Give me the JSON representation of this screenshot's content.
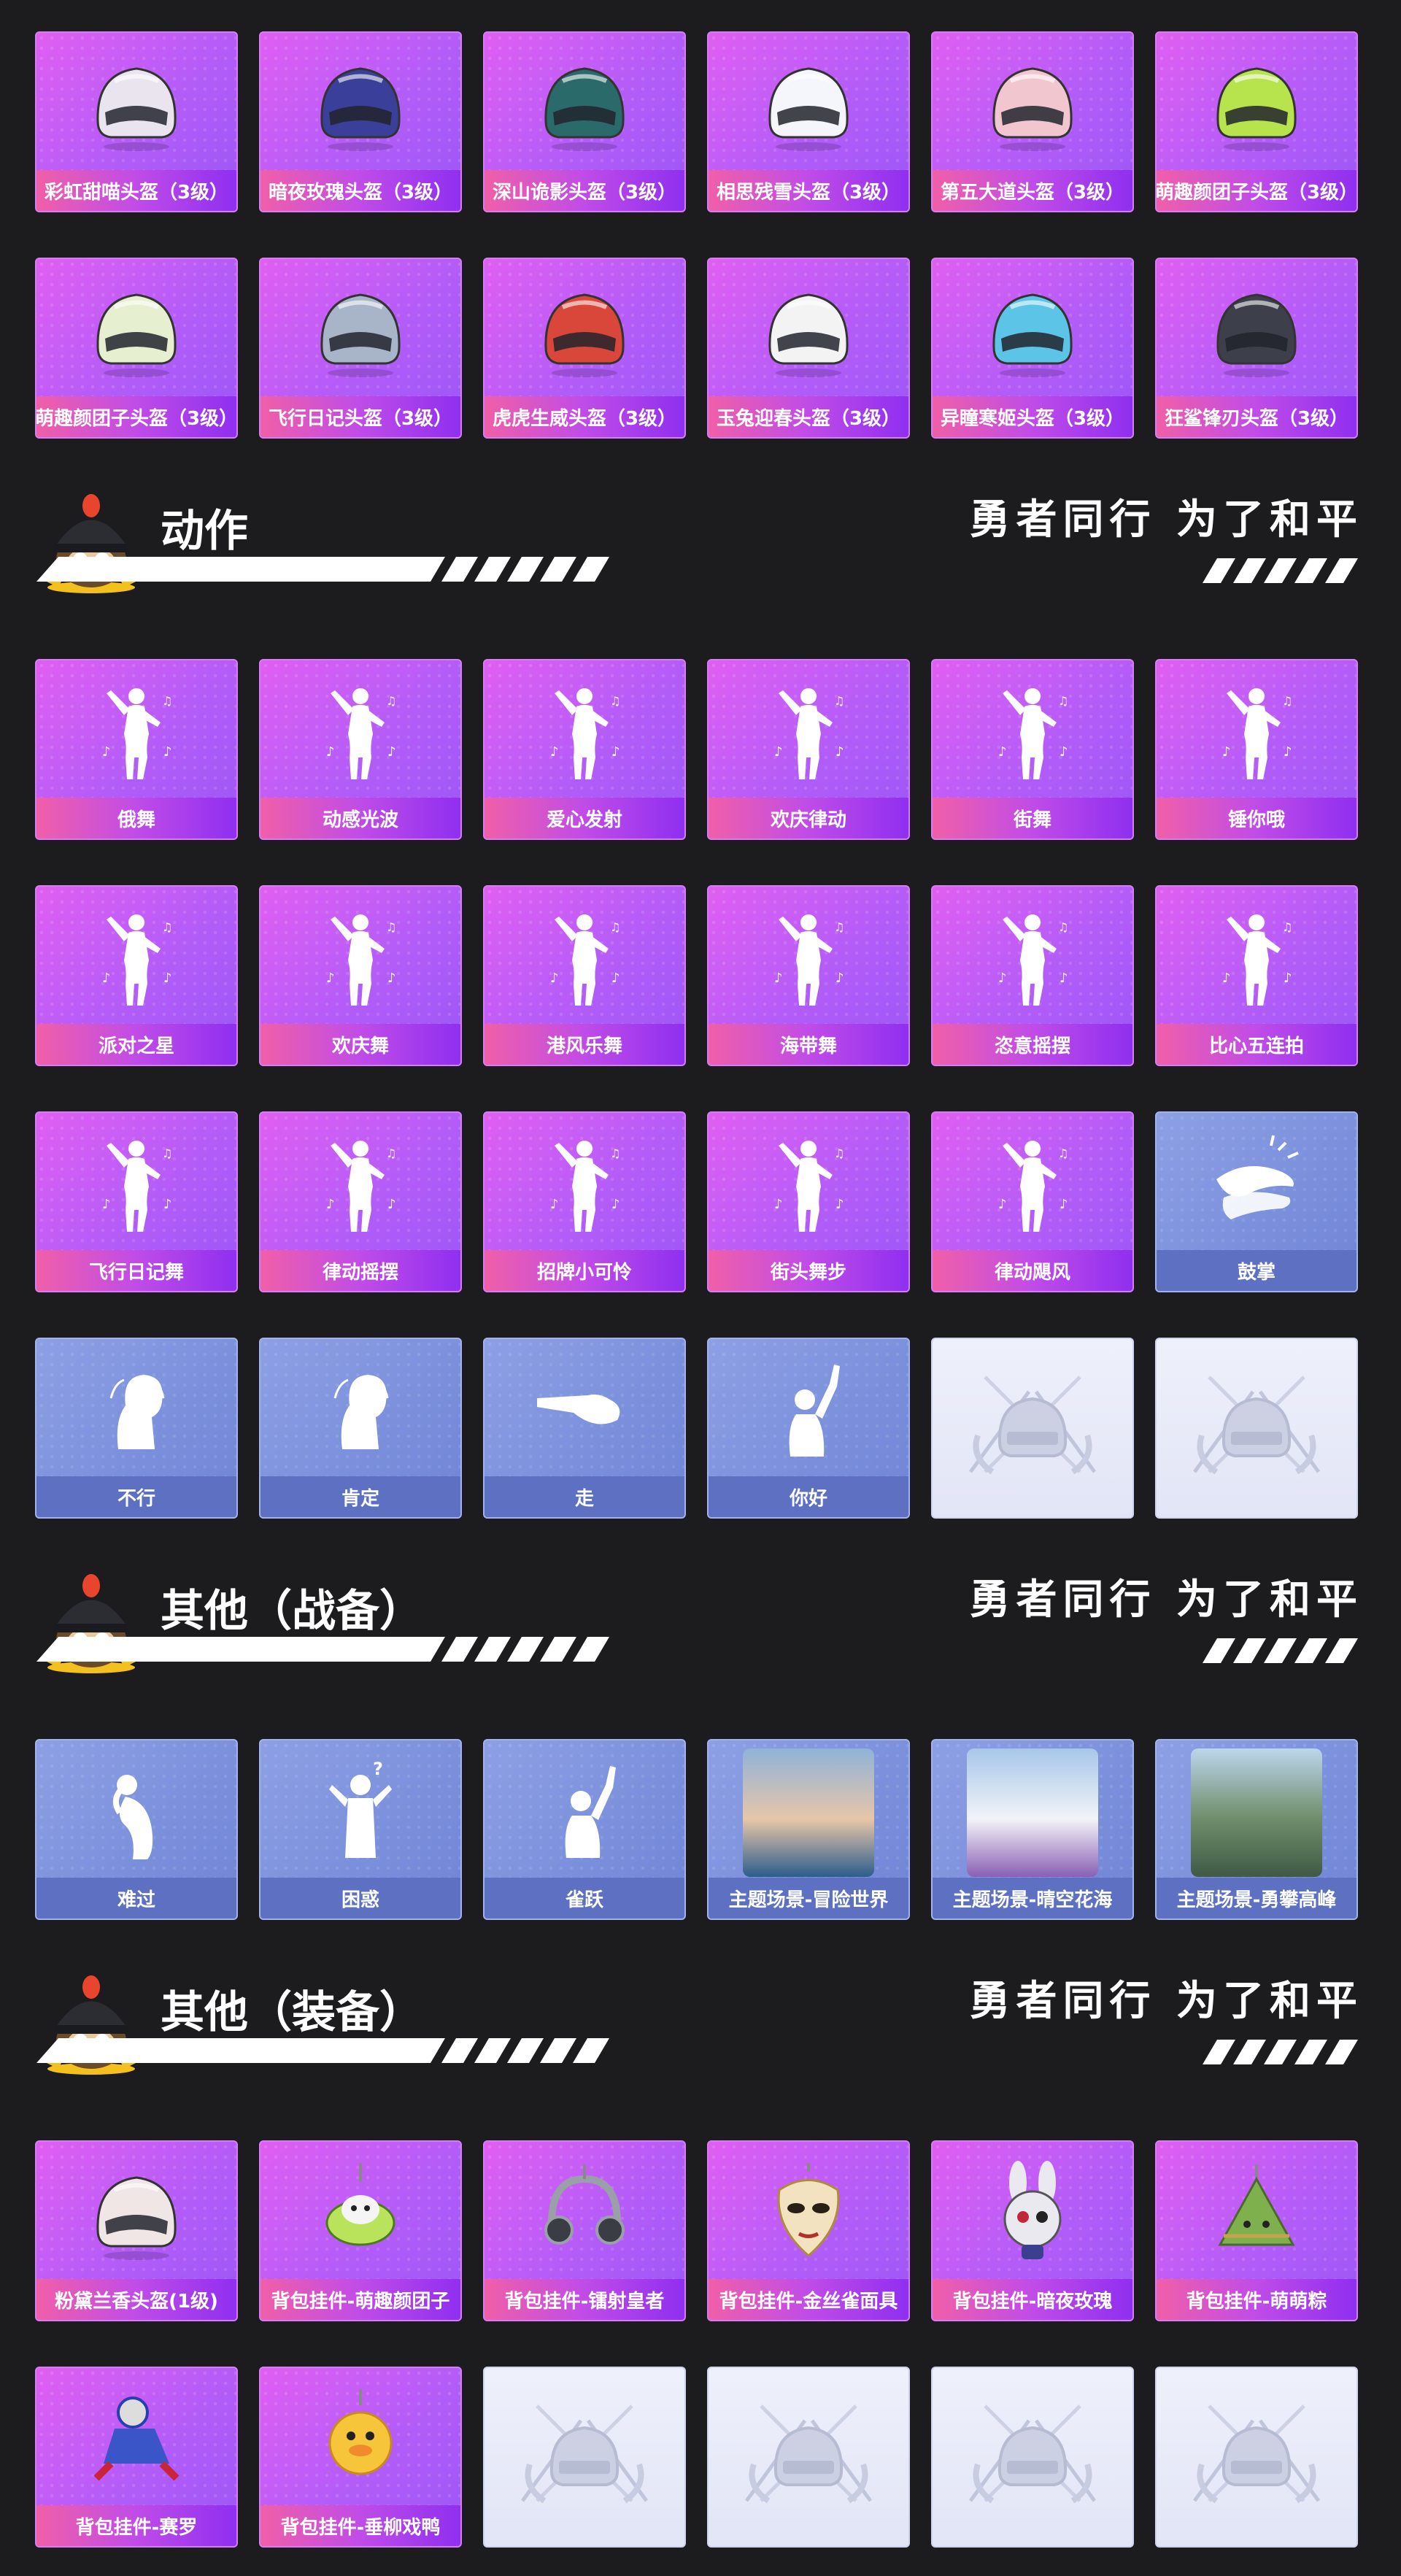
{
  "sections": {
    "helmets": {
      "rows": [
        [
          {
            "label": "彩虹甜喵头盔（3级）",
            "style": "purple",
            "icon": "helmet-icon",
            "color": "#e9e4ee"
          },
          {
            "label": "暗夜玫瑰头盔（3级）",
            "style": "purple",
            "icon": "helmet-icon",
            "color": "#3a3f9a"
          },
          {
            "label": "深山诡影头盔（3级）",
            "style": "purple",
            "icon": "helmet-icon",
            "color": "#2b6a6a"
          },
          {
            "label": "相思残雪头盔（3级）",
            "style": "purple",
            "icon": "helmet-icon",
            "color": "#f4f6fb"
          },
          {
            "label": "第五大道头盔（3级）",
            "style": "purple",
            "icon": "helmet-icon",
            "color": "#f2c6cf"
          },
          {
            "label": "萌趣颜团子头盔（3级）",
            "style": "purple",
            "icon": "helmet-icon",
            "color": "#b7e34d"
          }
        ],
        [
          {
            "label": "萌趣颜团子头盔（3级）",
            "style": "purple",
            "icon": "helmet-icon",
            "color": "#e6f0d0"
          },
          {
            "label": "飞行日记头盔（3级）",
            "style": "purple",
            "icon": "helmet-icon",
            "color": "#a8b4c8"
          },
          {
            "label": "虎虎生威头盔（3级）",
            "style": "purple",
            "icon": "helmet-icon",
            "color": "#d8473a"
          },
          {
            "label": "玉兔迎春头盔（3级）",
            "style": "purple",
            "icon": "helmet-icon",
            "color": "#f3f3f3"
          },
          {
            "label": "异瞳寒姬头盔（3级）",
            "style": "purple",
            "icon": "helmet-icon",
            "color": "#5cc4e6"
          },
          {
            "label": "狂鲨锋刃头盔（3级）",
            "style": "purple",
            "icon": "helmet-icon",
            "color": "#3d3f4a"
          }
        ]
      ]
    },
    "actions": {
      "title": "动作",
      "slogan": "勇者同行 为了和平",
      "rows": [
        [
          {
            "label": "俄舞",
            "style": "purple",
            "icon": "dancer-icon"
          },
          {
            "label": "动感光波",
            "style": "purple",
            "icon": "dancer-icon"
          },
          {
            "label": "爱心发射",
            "style": "purple",
            "icon": "dancer-icon"
          },
          {
            "label": "欢庆律动",
            "style": "purple",
            "icon": "dancer-icon"
          },
          {
            "label": "街舞",
            "style": "purple",
            "icon": "dancer-icon"
          },
          {
            "label": "锤你哦",
            "style": "purple",
            "icon": "dancer-icon"
          }
        ],
        [
          {
            "label": "派对之星",
            "style": "purple",
            "icon": "dancer-icon"
          },
          {
            "label": "欢庆舞",
            "style": "purple",
            "icon": "dancer-icon"
          },
          {
            "label": "港风乐舞",
            "style": "purple",
            "icon": "dancer-icon"
          },
          {
            "label": "海带舞",
            "style": "purple",
            "icon": "dancer-icon"
          },
          {
            "label": "恣意摇摆",
            "style": "purple",
            "icon": "dancer-icon"
          },
          {
            "label": "比心五连拍",
            "style": "purple",
            "icon": "dancer-icon"
          }
        ],
        [
          {
            "label": "飞行日记舞",
            "style": "purple",
            "icon": "dancer-icon"
          },
          {
            "label": "律动摇摆",
            "style": "purple",
            "icon": "dancer-icon"
          },
          {
            "label": "招牌小可怜",
            "style": "purple",
            "icon": "dancer-icon"
          },
          {
            "label": "街头舞步",
            "style": "purple",
            "icon": "dancer-icon"
          },
          {
            "label": "律动飓风",
            "style": "purple",
            "icon": "dancer-icon"
          },
          {
            "label": "鼓掌",
            "style": "blue",
            "icon": "clap-icon"
          }
        ],
        [
          {
            "label": "不行",
            "style": "blue",
            "icon": "head-shake-icon"
          },
          {
            "label": "肯定",
            "style": "blue",
            "icon": "head-nod-icon"
          },
          {
            "label": "走",
            "style": "blue",
            "icon": "pointing-hand-icon"
          },
          {
            "label": "你好",
            "style": "blue",
            "icon": "wave-icon"
          },
          {
            "label": "",
            "style": "empty",
            "icon": "placeholder-emblem-icon"
          },
          {
            "label": "",
            "style": "empty",
            "icon": "placeholder-emblem-icon"
          }
        ]
      ]
    },
    "others_gear": {
      "title": "其他（战备）",
      "slogan": "勇者同行 为了和平",
      "rows": [
        [
          {
            "label": "难过",
            "style": "blue",
            "icon": "sad-pose-icon"
          },
          {
            "label": "困惑",
            "style": "blue",
            "icon": "confused-pose-icon"
          },
          {
            "label": "雀跃",
            "style": "blue",
            "icon": "cheer-pose-icon"
          },
          {
            "label": "主题场景-冒险世界",
            "style": "blue",
            "icon": "scene-image",
            "colors": [
              "#8fb3d9",
              "#e7c6a8",
              "#2c5d8c"
            ]
          },
          {
            "label": "主题场景-晴空花海",
            "style": "blue",
            "icon": "scene-image",
            "colors": [
              "#a7c7ea",
              "#f3f3f7",
              "#8a5fb5"
            ]
          },
          {
            "label": "主题场景-勇攀高峰",
            "style": "blue",
            "icon": "scene-image",
            "colors": [
              "#bcd6ec",
              "#6f8d6a",
              "#3f5a45"
            ]
          }
        ]
      ]
    },
    "others_equipment": {
      "title": "其他（装备）",
      "slogan": "勇者同行 为了和平",
      "rows": [
        [
          {
            "label": "粉黛兰香头盔(1级)",
            "style": "purple",
            "icon": "helmet-icon",
            "color": "#f1e6e6"
          },
          {
            "label": "背包挂件-萌趣颜团子",
            "style": "purple",
            "icon": "pendant-icon",
            "color": "#b8e35a"
          },
          {
            "label": "背包挂件-镭射皇者",
            "style": "purple",
            "icon": "headphones-icon",
            "color": "#9aa0a8"
          },
          {
            "label": "背包挂件-金丝雀面具",
            "style": "purple",
            "icon": "mask-icon",
            "color": "#f2e2c0"
          },
          {
            "label": "背包挂件-暗夜玫瑰",
            "style": "purple",
            "icon": "rabbit-icon",
            "color": "#e9e9ef"
          },
          {
            "label": "背包挂件-萌萌粽",
            "style": "purple",
            "icon": "zongzi-icon",
            "color": "#7fb04e"
          }
        ],
        [
          {
            "label": "背包挂件-赛罗",
            "style": "purple",
            "icon": "hero-figure-icon",
            "color": "#3a55c8"
          },
          {
            "label": "背包挂件-垂柳戏鸭",
            "style": "purple",
            "icon": "duck-icon",
            "color": "#f6c53a"
          },
          {
            "label": "",
            "style": "empty",
            "icon": "placeholder-emblem-icon"
          },
          {
            "label": "",
            "style": "empty",
            "icon": "placeholder-emblem-icon"
          },
          {
            "label": "",
            "style": "empty",
            "icon": "placeholder-emblem-icon"
          },
          {
            "label": "",
            "style": "empty",
            "icon": "placeholder-emblem-icon"
          }
        ]
      ]
    }
  },
  "colors": {
    "background": "#1c1c1e",
    "card_purple": "#c05cf6",
    "card_blue": "#7a8fdc",
    "card_empty": "#e6e9f7",
    "accent_white": "#ffffff"
  }
}
